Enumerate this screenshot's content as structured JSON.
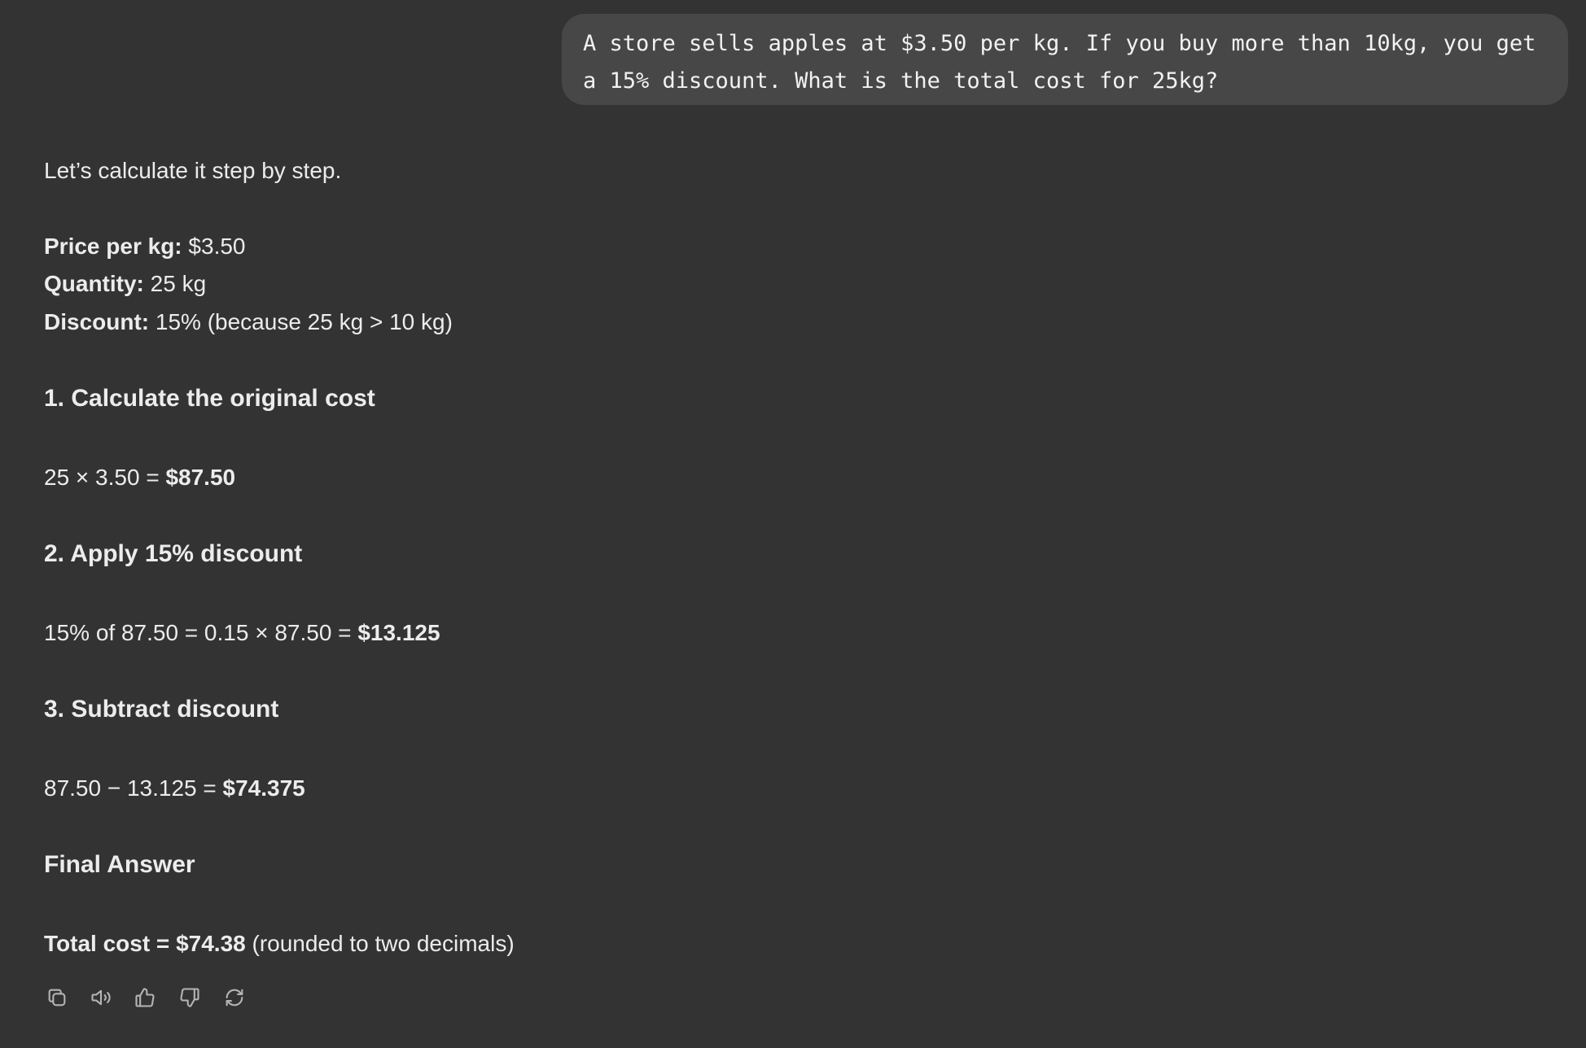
{
  "user_message": {
    "text": "A store sells apples at $3.50 per kg. If you buy more than 10kg, you get a 15% discount. What is the total cost for 25kg?"
  },
  "assistant": {
    "intro": "Let’s calculate it step by step.",
    "givens": [
      {
        "label": "Price per kg:",
        "value": " $3.50"
      },
      {
        "label": "Quantity:",
        "value": " 25 kg"
      },
      {
        "label": "Discount:",
        "value": " 15% (because 25 kg > 10 kg)"
      }
    ],
    "steps": [
      {
        "heading": "1. Calculate the original cost",
        "expr": "25 × 3.50 = ",
        "result": "$87.50"
      },
      {
        "heading": "2. Apply 15% discount",
        "expr": "15% of 87.50 = 0.15 × 87.50 = ",
        "result": "$13.125"
      },
      {
        "heading": "3. Subtract discount",
        "expr": "87.50 − 13.125 = ",
        "result": "$74.375"
      }
    ],
    "final_heading": "Final Answer",
    "final_label": "Total cost = $74.38",
    "final_note": " (rounded to two decimals)"
  },
  "actions": [
    {
      "name": "copy-icon"
    },
    {
      "name": "read-aloud-icon"
    },
    {
      "name": "thumbs-up-icon"
    },
    {
      "name": "thumbs-down-icon"
    },
    {
      "name": "regenerate-icon"
    }
  ],
  "colors": {
    "background": "#333333",
    "user_bubble": "#474747",
    "text": "#ececec",
    "icon": "#b4b4b4"
  }
}
